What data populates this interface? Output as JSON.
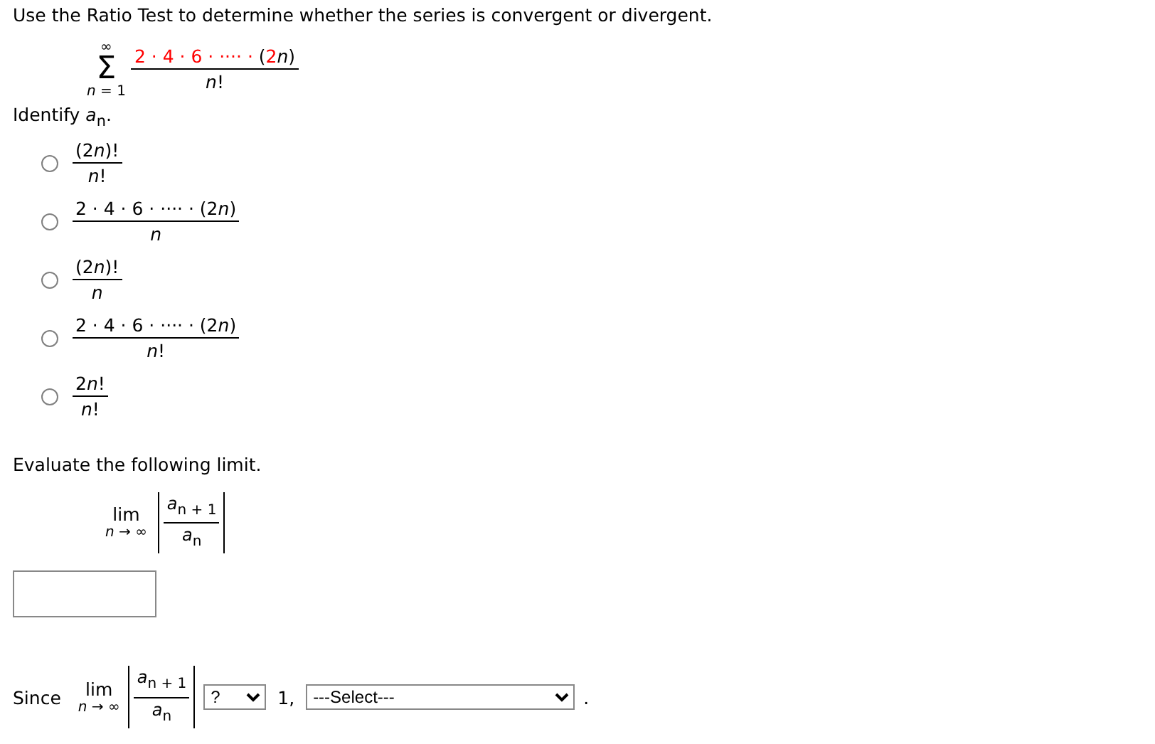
{
  "instruction": "Use the Ratio Test to determine whether the series is convergent or divergent.",
  "series": {
    "upper": "∞",
    "symbol": "Σ",
    "lower": [
      {
        "text": "n",
        "italic": true
      },
      {
        "text": " = 1",
        "italic": false
      }
    ],
    "numerator_parts": [
      {
        "text": "2 · 4 · 6 · ···· · ",
        "color": "#ff0000",
        "italic": false
      },
      {
        "text": "(",
        "color": "#000000",
        "italic": false
      },
      {
        "text": "2",
        "color": "#ff0000",
        "italic": false
      },
      {
        "text": "n",
        "color": "#000000",
        "italic": true
      },
      {
        "text": ")",
        "color": "#000000",
        "italic": false
      }
    ],
    "denominator": [
      {
        "text": "n",
        "italic": true
      },
      {
        "text": "!",
        "italic": false
      }
    ]
  },
  "identify_prompt": "Identify *a*$_{n}$.",
  "options": [
    {
      "numerator": [
        {
          "text": "(2",
          "italic": false
        },
        {
          "text": "n",
          "italic": true
        },
        {
          "text": ")!",
          "italic": false
        }
      ],
      "denominator": [
        {
          "text": "n",
          "italic": true
        },
        {
          "text": "!",
          "italic": false
        }
      ],
      "selected": false
    },
    {
      "numerator": [
        {
          "text": "2 · 4 · 6 · ···· · (2",
          "italic": false
        },
        {
          "text": "n",
          "italic": true
        },
        {
          "text": ")",
          "italic": false
        }
      ],
      "denominator": [
        {
          "text": "n",
          "italic": true
        }
      ],
      "selected": false
    },
    {
      "numerator": [
        {
          "text": "(2",
          "italic": false
        },
        {
          "text": "n",
          "italic": true
        },
        {
          "text": ")!",
          "italic": false
        }
      ],
      "denominator": [
        {
          "text": "n",
          "italic": true
        }
      ],
      "selected": false
    },
    {
      "numerator": [
        {
          "text": "2 · 4 · 6 · ···· · (2",
          "italic": false
        },
        {
          "text": "n",
          "italic": true
        },
        {
          "text": ")",
          "italic": false
        }
      ],
      "denominator": [
        {
          "text": "n",
          "italic": true
        },
        {
          "text": "!",
          "italic": false
        }
      ],
      "selected": false
    },
    {
      "numerator": [
        {
          "text": "2",
          "italic": false
        },
        {
          "text": "n",
          "italic": true
        },
        {
          "text": "!",
          "italic": false
        }
      ],
      "denominator": [
        {
          "text": "n",
          "italic": true
        },
        {
          "text": "!",
          "italic": false
        }
      ],
      "selected": false
    }
  ],
  "limit_prompt": "Evaluate the following limit.",
  "limit": {
    "lim": "lim",
    "under": "*n* → ∞",
    "numerator": "*a*$_{n + 1}$",
    "denominator": "*a*$_{n}$"
  },
  "conclusion": {
    "since": "Since",
    "lim": "lim",
    "under": "*n* → ∞",
    "numerator": "*a*$_{n + 1}$",
    "denominator": "*a*$_{n}$",
    "comparison_select": "?",
    "number": "1,",
    "conclusion_select": "---Select---",
    "end": "."
  }
}
